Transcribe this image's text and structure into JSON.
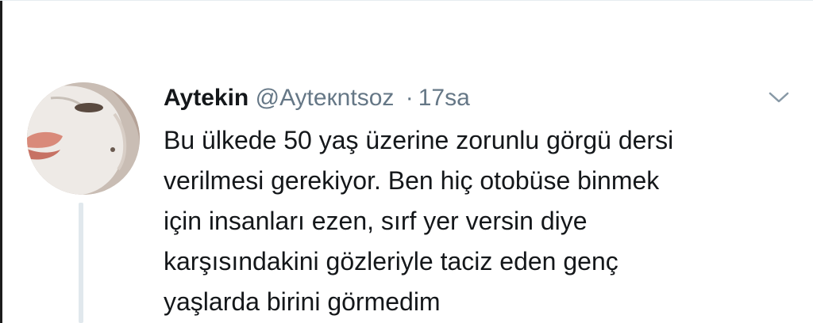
{
  "tweet": {
    "display_name": "Aytekin",
    "handle": "@Ayteкntsoz",
    "separator": "·",
    "timestamp": "17sa",
    "text_lines": [
      "Bu ülkede 50 yaş üzerine zorunlu görgü dersi",
      "verilmesi gerekiyor. Ben hiç otobüse binmek",
      "için insanları ezen, sırf yer versin diye",
      "karşısındakini gözleriyle taciz eden genç",
      "yaşlarda birini görmedim"
    ]
  },
  "icons": {
    "menu": "chevron-down-icon",
    "avatar": "profile-photo"
  },
  "colors": {
    "text": "#14171a",
    "secondary": "#657786",
    "thread_line": "#e1e8ed"
  }
}
